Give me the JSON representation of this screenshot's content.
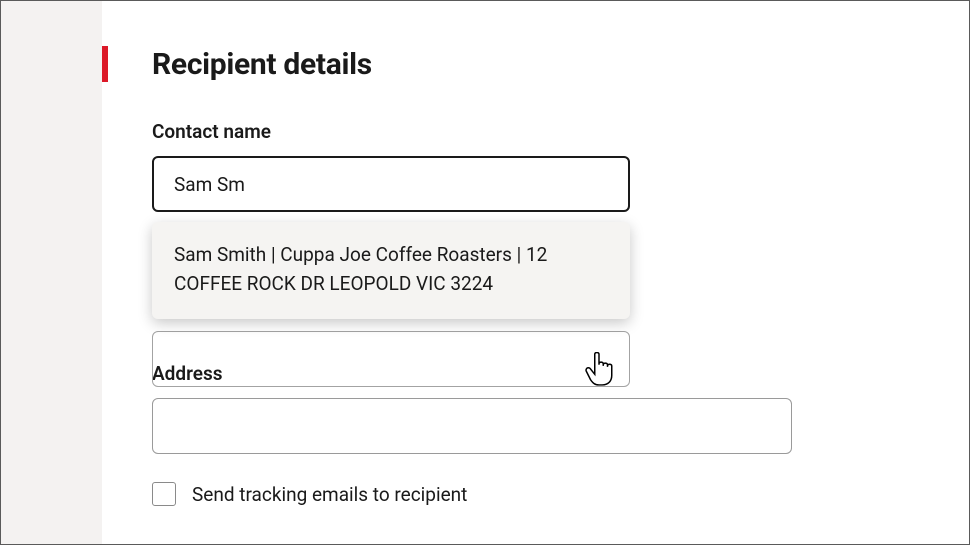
{
  "section": {
    "title": "Recipient details"
  },
  "contact": {
    "label": "Contact name",
    "value": "Sam Sm",
    "suggestion": "Sam Smith | Cuppa Joe Coffee Roasters | 12 COFFEE ROCK DR LEOPOLD VIC 3224"
  },
  "address": {
    "label": "Address",
    "value": ""
  },
  "tracking": {
    "label": "Send tracking emails to recipient",
    "checked": false
  }
}
